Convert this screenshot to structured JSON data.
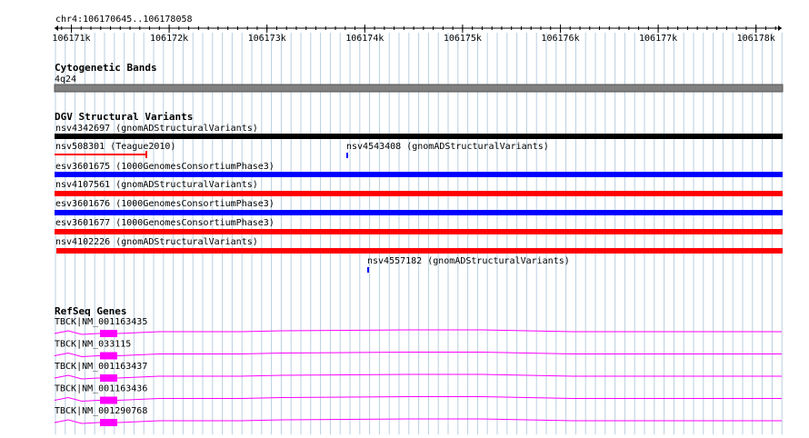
{
  "location": "chr4:106170645..106178058",
  "ruler": {
    "ticks": [
      "106171k",
      "106172k",
      "106173k",
      "106174k",
      "106175k",
      "106176k",
      "106177k",
      "106178k"
    ]
  },
  "tracks": {
    "cytobands": {
      "title": "Cytogenetic Bands",
      "band_label": "4q24",
      "color": "#808080"
    },
    "dgv": {
      "title": "DGV Structural Variants",
      "features": [
        {
          "label": "nsv4342697 (gnomADStructuralVariants)",
          "color": "#000000"
        },
        {
          "label": "nsv508301 (Teague2010)",
          "color": "#ff0000"
        },
        {
          "label": "nsv4543408 (gnomADStructuralVariants)",
          "color": "#0000ff"
        },
        {
          "label": "esv3601675 (1000GenomesConsortiumPhase3)",
          "color": "#0000ff"
        },
        {
          "label": "nsv4107561 (gnomADStructuralVariants)",
          "color": "#ff0000"
        },
        {
          "label": "esv3601676 (1000GenomesConsortiumPhase3)",
          "color": "#0000ff"
        },
        {
          "label": "esv3601677 (1000GenomesConsortiumPhase3)",
          "color": "#ff0000"
        },
        {
          "label": "nsv4102226 (gnomADStructuralVariants)",
          "color": "#ff0000"
        },
        {
          "label": "nsv4557182 (gnomADStructuralVariants)",
          "color": "#0000ff"
        }
      ]
    },
    "refseq": {
      "title": "RefSeq Genes",
      "color": "#ff00ff",
      "transcripts": [
        {
          "label": "TBCK|NM_001163435"
        },
        {
          "label": "TBCK|NM_033115"
        },
        {
          "label": "TBCK|NM_001163437"
        },
        {
          "label": "TBCK|NM_001163436"
        },
        {
          "label": "TBCK|NM_001290768"
        }
      ]
    }
  },
  "colors": {
    "grid": "#b8cfe0",
    "background": "#ffffff",
    "text": "#000000"
  }
}
